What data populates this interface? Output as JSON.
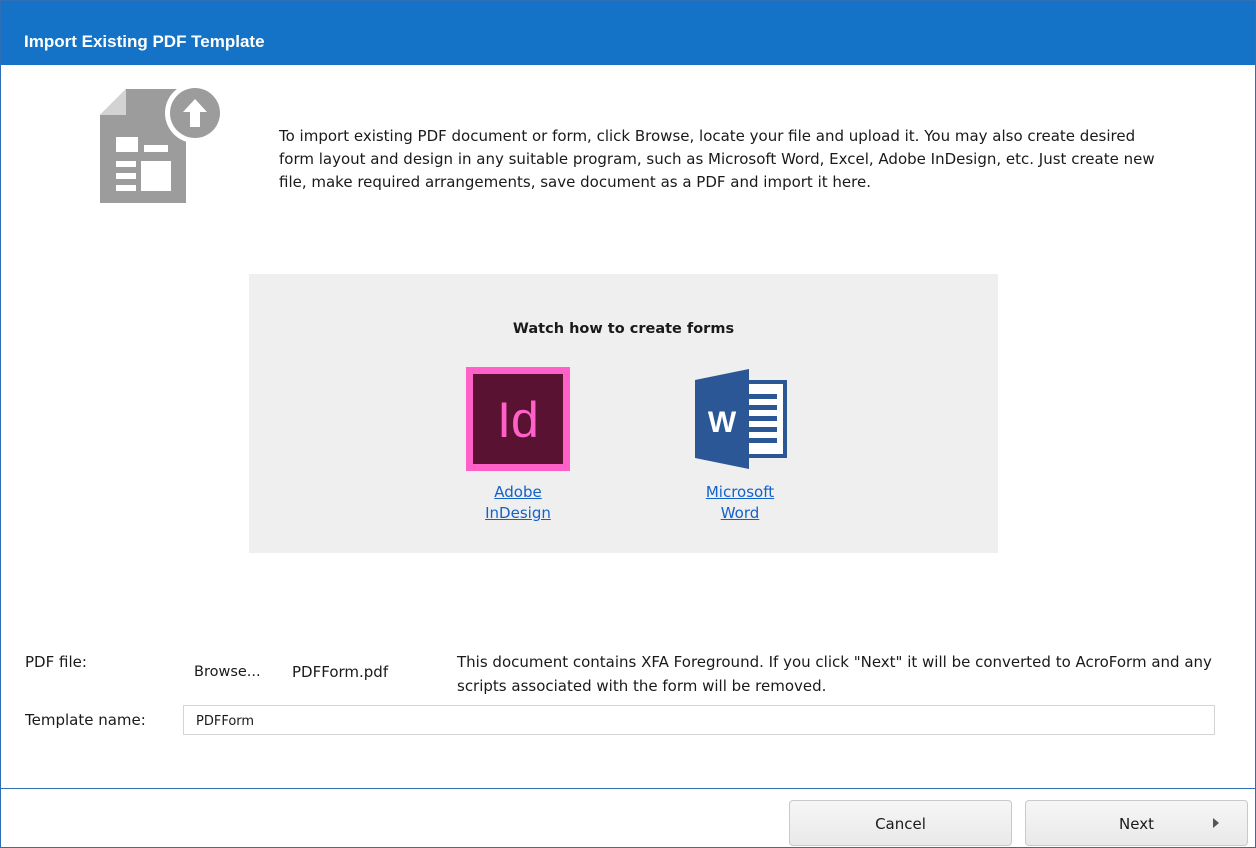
{
  "window": {
    "title": "Import Existing PDF Template"
  },
  "intro": {
    "text": "To import existing PDF document or form, click Browse, locate your file and upload it. You may also create desired form layout and design in any suitable program, such as Microsoft Word, Excel, Adobe InDesign, etc. Just create new file, make required arrangements, save document as a PDF and import it here."
  },
  "watch": {
    "title": "Watch how to create forms",
    "apps": [
      {
        "label_line1": "Adobe",
        "label_line2": "InDesign",
        "icon": "adobe-indesign-icon",
        "icon_text": "Id",
        "color": "#ff61c8"
      },
      {
        "label_line1": "Microsoft",
        "label_line2": "Word",
        "icon": "microsoft-word-icon",
        "icon_text": "W",
        "color": "#2b5797"
      }
    ]
  },
  "form": {
    "pdf_file_label": "PDF file:",
    "browse_label": "Browse...",
    "file_name": "PDFForm.pdf",
    "xfa_message": "This document contains XFA Foreground. If you click \"Next\" it will be converted to AcroForm and any scripts associated with the form will be removed.",
    "template_name_label": "Template name:",
    "template_name_value": "PDFForm"
  },
  "footer": {
    "cancel_label": "Cancel",
    "next_label": "Next"
  },
  "colors": {
    "titlebar": "#1473c6",
    "panel": "#efefef",
    "link": "#1262c9"
  }
}
